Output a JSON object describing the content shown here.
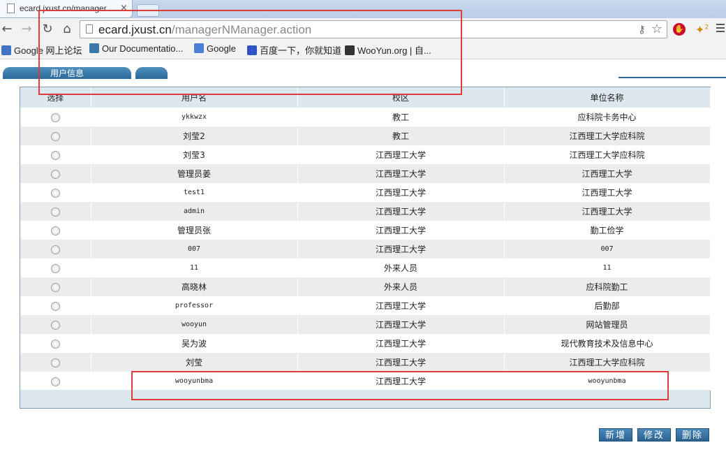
{
  "browser": {
    "tab_title": "ecard.jxust.cn/manager",
    "tab_close": "×",
    "url_host": "ecard.jxust.cn",
    "url_path": "/managerNManager.action",
    "ext_badge": "2"
  },
  "bookmarks": [
    {
      "label": "Google 网上论坛",
      "icon": "google-groups-icon",
      "color": "#3f74c9"
    },
    {
      "label": "Our Documentatio...",
      "icon": "python-icon",
      "color": "#3b77a8"
    },
    {
      "label": "Google",
      "icon": "google-icon",
      "color": "#4a7fd6"
    },
    {
      "label": "百度一下，你就知道",
      "icon": "baidu-icon",
      "color": "#2f53c6"
    },
    {
      "label": "WooYun.org | 自...",
      "icon": "wooyun-icon",
      "color": "#333333"
    }
  ],
  "page_tabs": [
    {
      "label": "用户信息"
    },
    {
      "label": ""
    }
  ],
  "table": {
    "headers": [
      "选择",
      "用户名",
      "校区",
      "单位名称"
    ],
    "rows": [
      {
        "username": "ykkwzx",
        "campus": "教工",
        "unit": "应科院卡务中心"
      },
      {
        "username": "刘莹2",
        "campus": "教工",
        "unit": "江西理工大学应科院"
      },
      {
        "username": "刘莹3",
        "campus": "江西理工大学",
        "unit": "江西理工大学应科院"
      },
      {
        "username": "管理员姜",
        "campus": "江西理工大学",
        "unit": "江西理工大学"
      },
      {
        "username": "test1",
        "campus": "江西理工大学",
        "unit": "江西理工大学"
      },
      {
        "username": "admin",
        "campus": "江西理工大学",
        "unit": "江西理工大学"
      },
      {
        "username": "管理员张",
        "campus": "江西理工大学",
        "unit": "勤工俭学"
      },
      {
        "username": "007",
        "campus": "江西理工大学",
        "unit": "007"
      },
      {
        "username": "11",
        "campus": "外来人员",
        "unit": "11"
      },
      {
        "username": "高晓林",
        "campus": "外来人员",
        "unit": "应科院勤工"
      },
      {
        "username": "professor",
        "campus": "江西理工大学",
        "unit": "后勤部"
      },
      {
        "username": "wooyun",
        "campus": "江西理工大学",
        "unit": "网站管理员"
      },
      {
        "username": "吴为波",
        "campus": "江西理工大学",
        "unit": "现代教育技术及信息中心"
      },
      {
        "username": "刘莹",
        "campus": "江西理工大学",
        "unit": "江西理工大学应科院"
      },
      {
        "username": "wooyunbma",
        "campus": "江西理工大学",
        "unit": "wooyunbma"
      }
    ]
  },
  "actions": {
    "add": "新增",
    "edit": "修改",
    "delete": "删除"
  },
  "colors": {
    "highlight": "#e03c3c",
    "accent": "#2d6a99",
    "header_bg": "#dde7ee"
  }
}
